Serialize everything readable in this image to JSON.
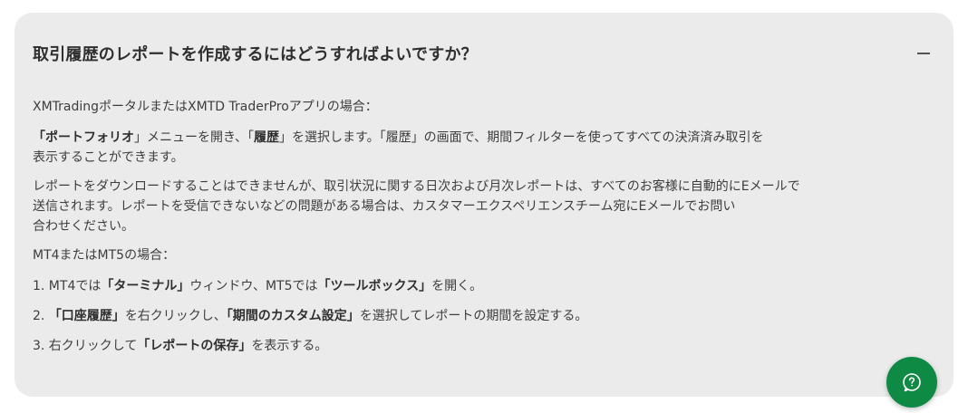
{
  "faq": {
    "question": "取引履歴のレポートを作成するにはどうすればよいですか？",
    "xm_intro": "XMTradingポータルまたはXMTD TraderProアプリの場合：",
    "p1": {
      "q1": "「",
      "b1": "ポートフォリオ",
      "q2": "」メニューを開き、「",
      "b2": "履歴",
      "q3": "」を選択します。「履歴」の画面で、期間フィルターを使ってすべての決済済み取引を",
      "line2": "表示することができます。"
    },
    "p2": {
      "line1": "レポートをダウンロードすることはできませんが、取引状況に関する日次および月次レポートは、すべてのお客様に自動的にEメールで",
      "line2": "送信されます。レポートを受信できないなどの問題がある場合は、カスタマーエクスペリエンスチーム宛にEメールでお問い",
      "line3": "合わせください。"
    },
    "mt_intro": "MT4またはMT5の場合：",
    "step1": {
      "a": "1. MT4では",
      "b1": "「ターミナル」",
      "c": "ウィンドウ、MT5では",
      "b2": "「ツールボックス」",
      "d": "を開く。"
    },
    "step2": {
      "a": "2. ",
      "b1": "「口座履歴」",
      "c": "を右クリックし、",
      "b2": "「期間のカスタム設定」",
      "d": "を選択してレポートの期間を設定する。"
    },
    "step3": {
      "a": "3. 右クリックして",
      "b1": "「レポートの保存」",
      "d": "を表示する。"
    }
  },
  "colors": {
    "card_background": "#ebebeb",
    "chat_button": "#0f8a45"
  },
  "icons": {
    "toggle": "minus-icon",
    "chat": "chat-help-icon"
  }
}
